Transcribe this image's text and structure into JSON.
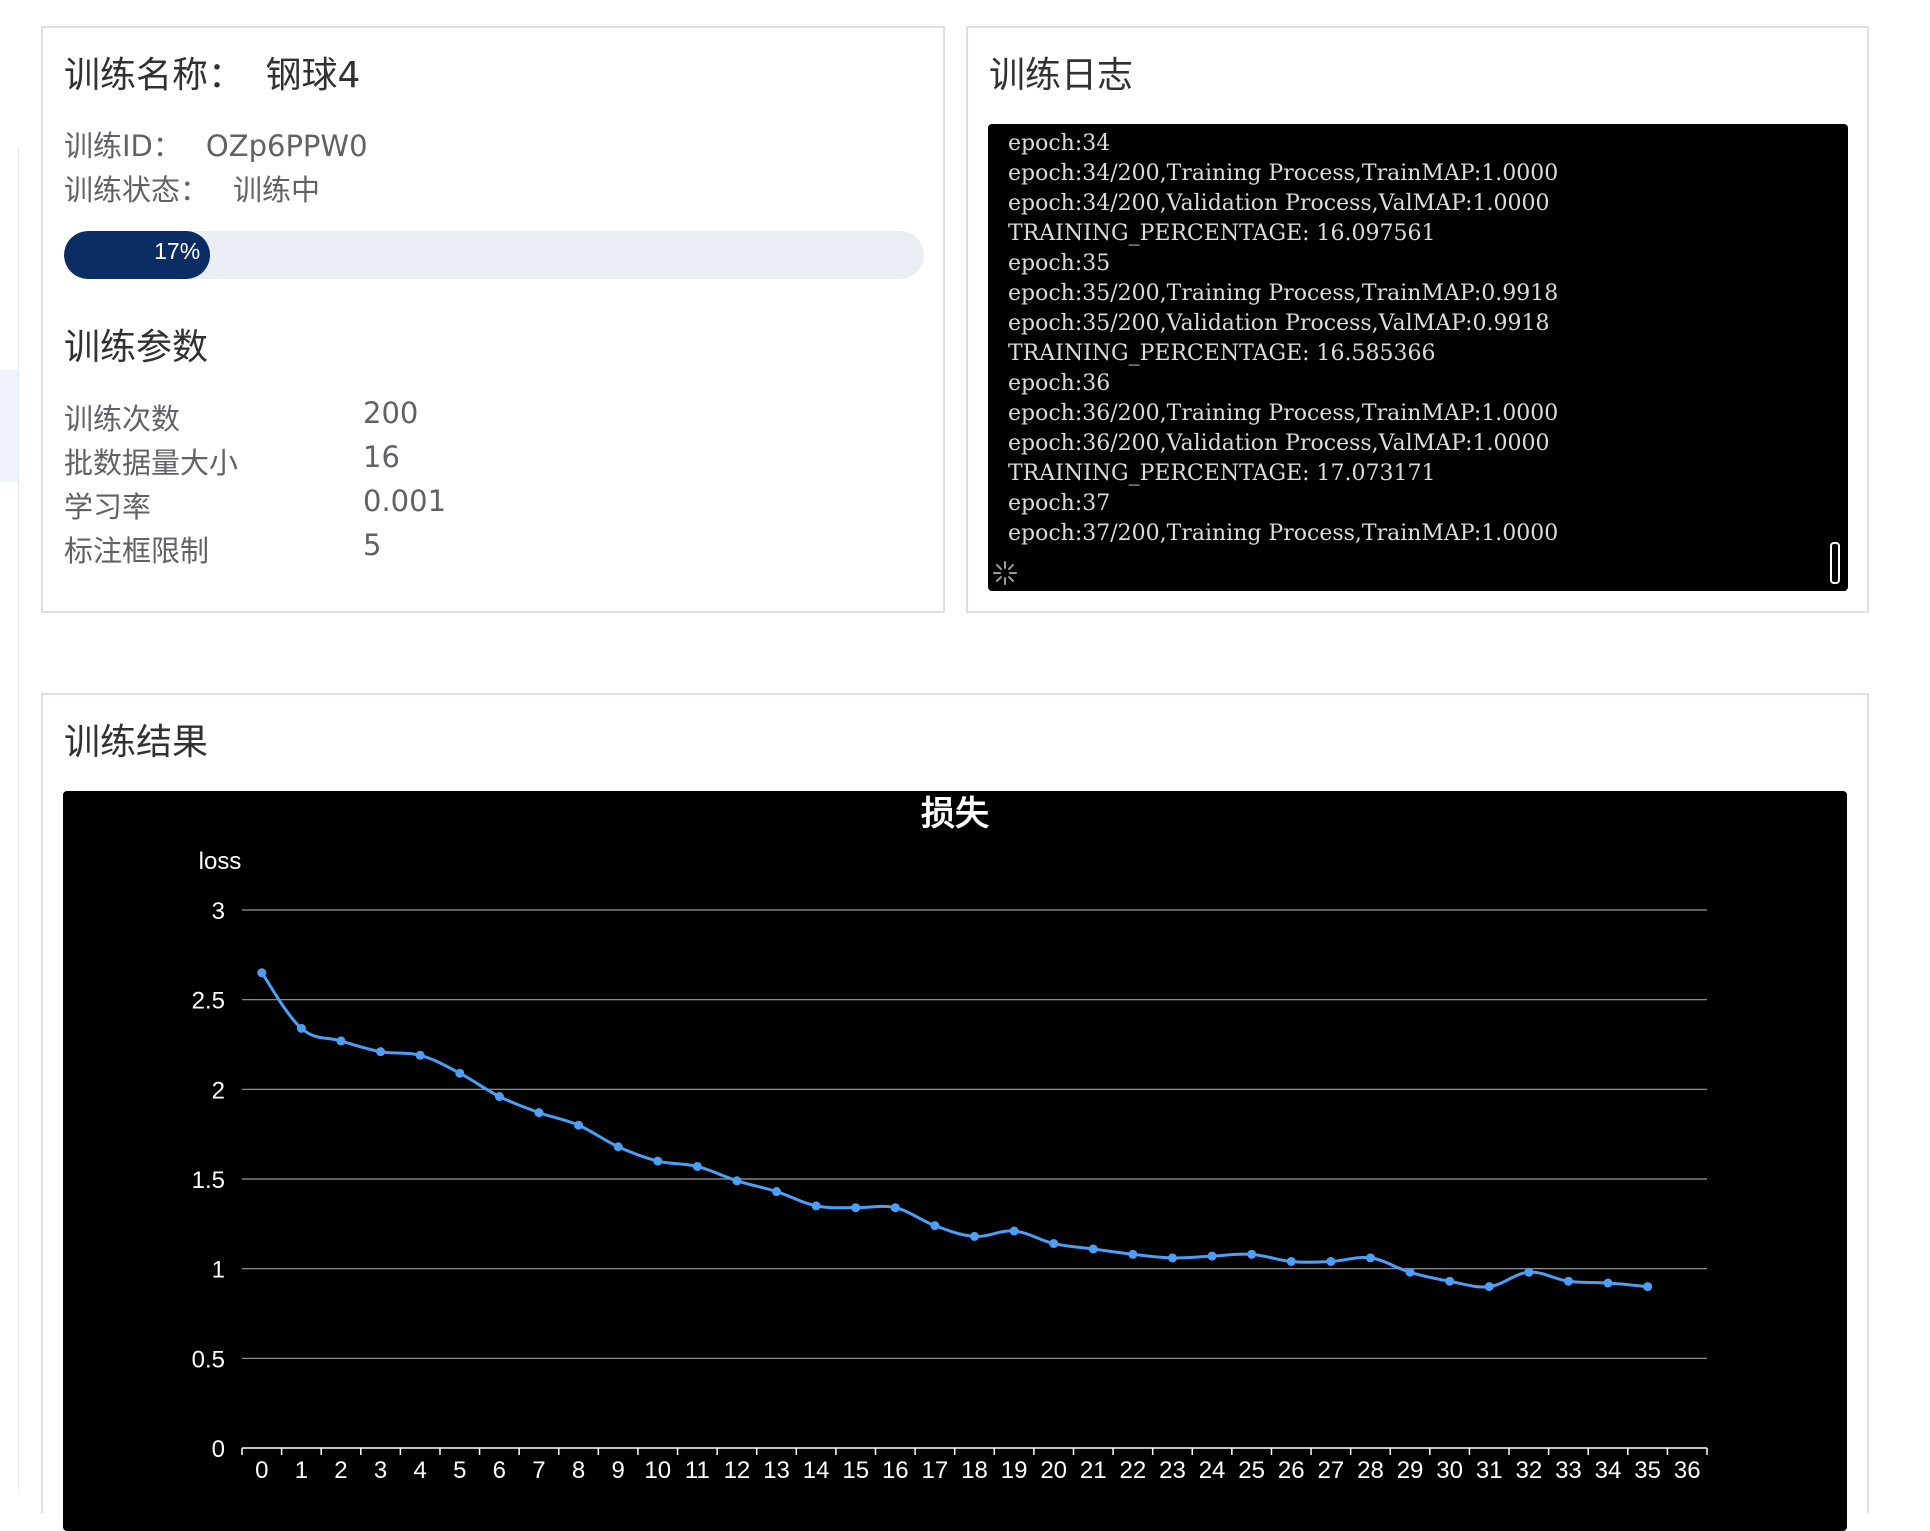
{
  "training": {
    "name_label": "训练名称：",
    "name_value": "钢球4",
    "id_label": "训练ID：",
    "id_value": "OZp6PPW0",
    "status_label": "训练状态：",
    "status_value": "训练中",
    "progress_percent": 17,
    "progress_text": "17%"
  },
  "params": {
    "title": "训练参数",
    "rows": [
      {
        "label": "训练次数",
        "value": "200"
      },
      {
        "label": "批数据量大小",
        "value": "16"
      },
      {
        "label": "学习率",
        "value": "0.001"
      },
      {
        "label": "标注框限制",
        "value": "5"
      }
    ]
  },
  "log": {
    "title": "训练日志",
    "lines": [
      "epoch:34",
      "epoch:34/200,Training Process,TrainMAP:1.0000",
      "epoch:34/200,Validation Process,ValMAP:1.0000",
      "TRAINING_PERCENTAGE: 16.097561",
      "epoch:35",
      "epoch:35/200,Training Process,TrainMAP:0.9918",
      "epoch:35/200,Validation Process,ValMAP:0.9918",
      "TRAINING_PERCENTAGE: 16.585366",
      "epoch:36",
      "epoch:36/200,Training Process,TrainMAP:1.0000",
      "epoch:36/200,Validation Process,ValMAP:1.0000",
      "TRAINING_PERCENTAGE: 17.073171",
      "epoch:37",
      "epoch:37/200,Training Process,TrainMAP:1.0000"
    ]
  },
  "result": {
    "title": "训练结果"
  },
  "chart_data": {
    "type": "line",
    "title": "损失",
    "ylabel": "loss",
    "xlabel": "",
    "ylim": [
      0,
      3
    ],
    "yticks": [
      0,
      0.5,
      1,
      1.5,
      2,
      2.5,
      3
    ],
    "grid": true,
    "smooth": true,
    "line_color": "#4d9ef5",
    "x": [
      0,
      1,
      2,
      3,
      4,
      5,
      6,
      7,
      8,
      9,
      10,
      11,
      12,
      13,
      14,
      15,
      16,
      17,
      18,
      19,
      20,
      21,
      22,
      23,
      24,
      25,
      26,
      27,
      28,
      29,
      30,
      31,
      32,
      33,
      34,
      35,
      36
    ],
    "values": [
      2.65,
      2.34,
      2.27,
      2.21,
      2.19,
      2.09,
      1.96,
      1.87,
      1.8,
      1.68,
      1.6,
      1.57,
      1.49,
      1.43,
      1.35,
      1.34,
      1.34,
      1.24,
      1.18,
      1.21,
      1.14,
      1.11,
      1.08,
      1.06,
      1.07,
      1.08,
      1.04,
      1.04,
      1.06,
      0.98,
      0.93,
      0.9,
      0.98,
      0.93,
      0.92,
      0.9
    ]
  }
}
